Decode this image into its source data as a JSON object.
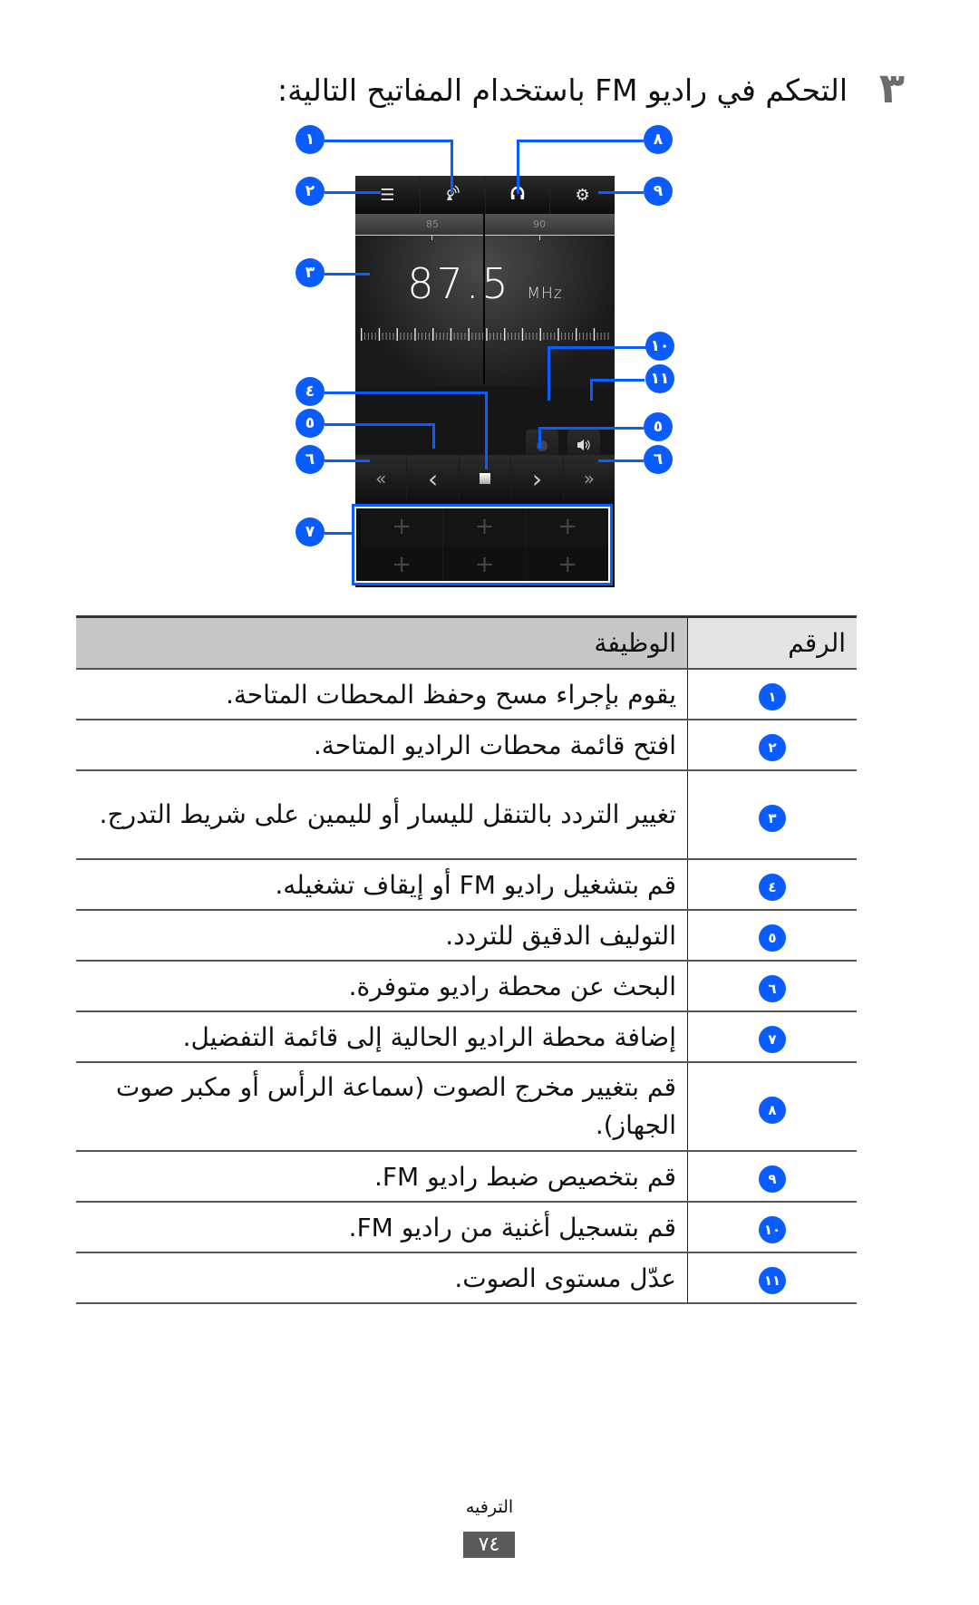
{
  "heading": {
    "step_number": "٣",
    "text": "التحكم في راديو FM باستخدام المفاتيح التالية:"
  },
  "phone_screen": {
    "top_bar": [
      {
        "icon": "list-icon",
        "glyph": "☰"
      },
      {
        "icon": "scan-antenna-icon",
        "glyph": "📡"
      },
      {
        "icon": "headphones-icon",
        "glyph": "🎧"
      },
      {
        "icon": "gear-icon",
        "glyph": "⚙"
      }
    ],
    "scale_labels": [
      "85",
      "90"
    ],
    "frequency": "87.5",
    "frequency_unit": "MHz",
    "record_icon": "●",
    "volume_icon": "🔊",
    "controls": [
      {
        "icon": "search-backward-icon",
        "glyph": "«"
      },
      {
        "icon": "fine-tune-down-icon",
        "glyph": "‹"
      },
      {
        "icon": "stop-icon",
        "glyph": "■"
      },
      {
        "icon": "fine-tune-up-icon",
        "glyph": "›"
      },
      {
        "icon": "search-forward-icon",
        "glyph": "»"
      }
    ],
    "favorites": [
      "+",
      "+",
      "+",
      "+",
      "+",
      "+"
    ]
  },
  "callouts": [
    "١",
    "٢",
    "٣",
    "٤",
    "٥",
    "٦",
    "٧",
    "٨",
    "٩",
    "١٠",
    "١١",
    "٥",
    "٦"
  ],
  "accent_color": "#0a5cff",
  "table": {
    "headers": {
      "number": "الرقم",
      "function": "الوظيفة"
    },
    "rows": [
      {
        "badge": "١",
        "text": "يقوم بإجراء مسح وحفظ المحطات المتاحة."
      },
      {
        "badge": "٢",
        "text": "افتح قائمة محطات الراديو المتاحة."
      },
      {
        "badge": "٣",
        "text": "تغيير التردد بالتنقل لليسار أو لليمين على شريط التدرج."
      },
      {
        "badge": "٤",
        "text": "قم بتشغيل راديو FM أو إيقاف تشغيله."
      },
      {
        "badge": "٥",
        "text": "التوليف الدقيق للتردد."
      },
      {
        "badge": "٦",
        "text": "البحث عن محطة راديو متوفرة."
      },
      {
        "badge": "٧",
        "text": "إضافة محطة الراديو الحالية إلى قائمة التفضيل."
      },
      {
        "badge": "٨",
        "text": "قم بتغيير مخرج الصوت (سماعة الرأس أو مكبر صوت الجهاز)."
      },
      {
        "badge": "٩",
        "text": "قم بتخصيص ضبط راديو FM."
      },
      {
        "badge": "١٠",
        "text": "قم بتسجيل أغنية من راديو FM."
      },
      {
        "badge": "١١",
        "text": "عدّل مستوى الصوت."
      }
    ]
  },
  "footer": {
    "section": "الترفيه",
    "page_number": "٧٤"
  }
}
